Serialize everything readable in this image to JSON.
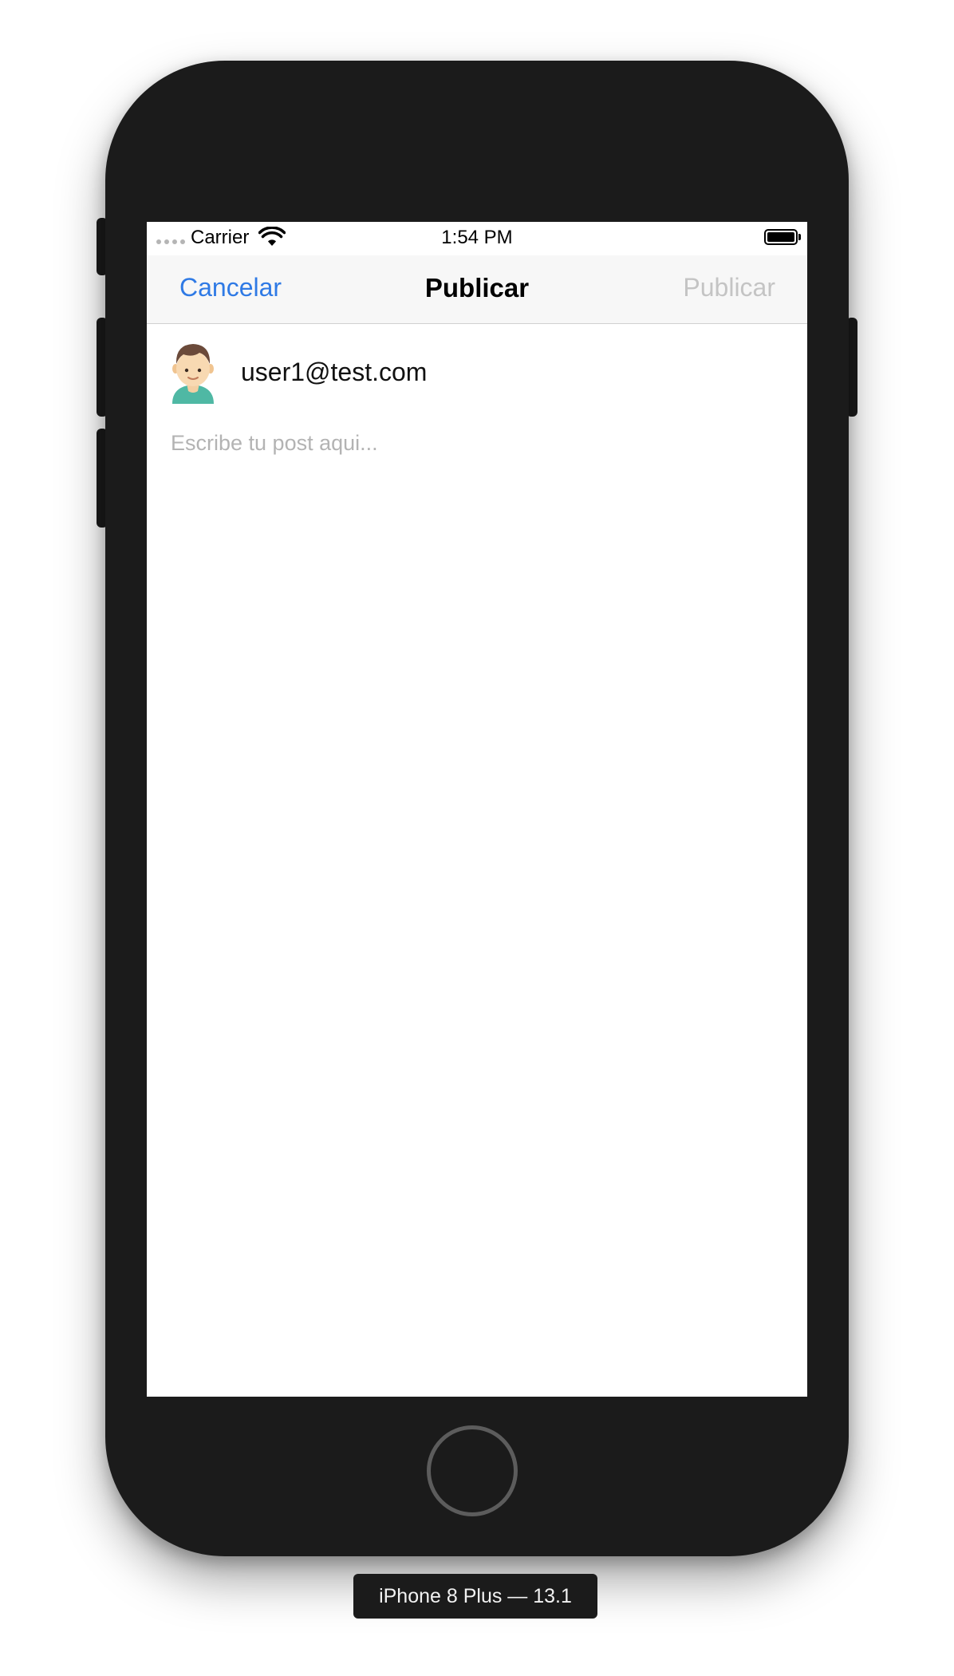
{
  "status_bar": {
    "carrier": "Carrier",
    "time": "1:54 PM",
    "wifi_icon": "wifi-icon",
    "battery_icon": "battery-icon"
  },
  "nav": {
    "cancel_label": "Cancelar",
    "title": "Publicar",
    "publish_label": "Publicar"
  },
  "user": {
    "email": "user1@test.com",
    "avatar_icon": "user-avatar-icon"
  },
  "composer": {
    "placeholder": "Escribe tu post aqui...",
    "value": ""
  },
  "device": {
    "label": "iPhone 8 Plus — 13.1"
  },
  "colors": {
    "accent": "#2f7ae5",
    "disabled": "#c4c4c4",
    "device_body": "#1b1b1b"
  }
}
